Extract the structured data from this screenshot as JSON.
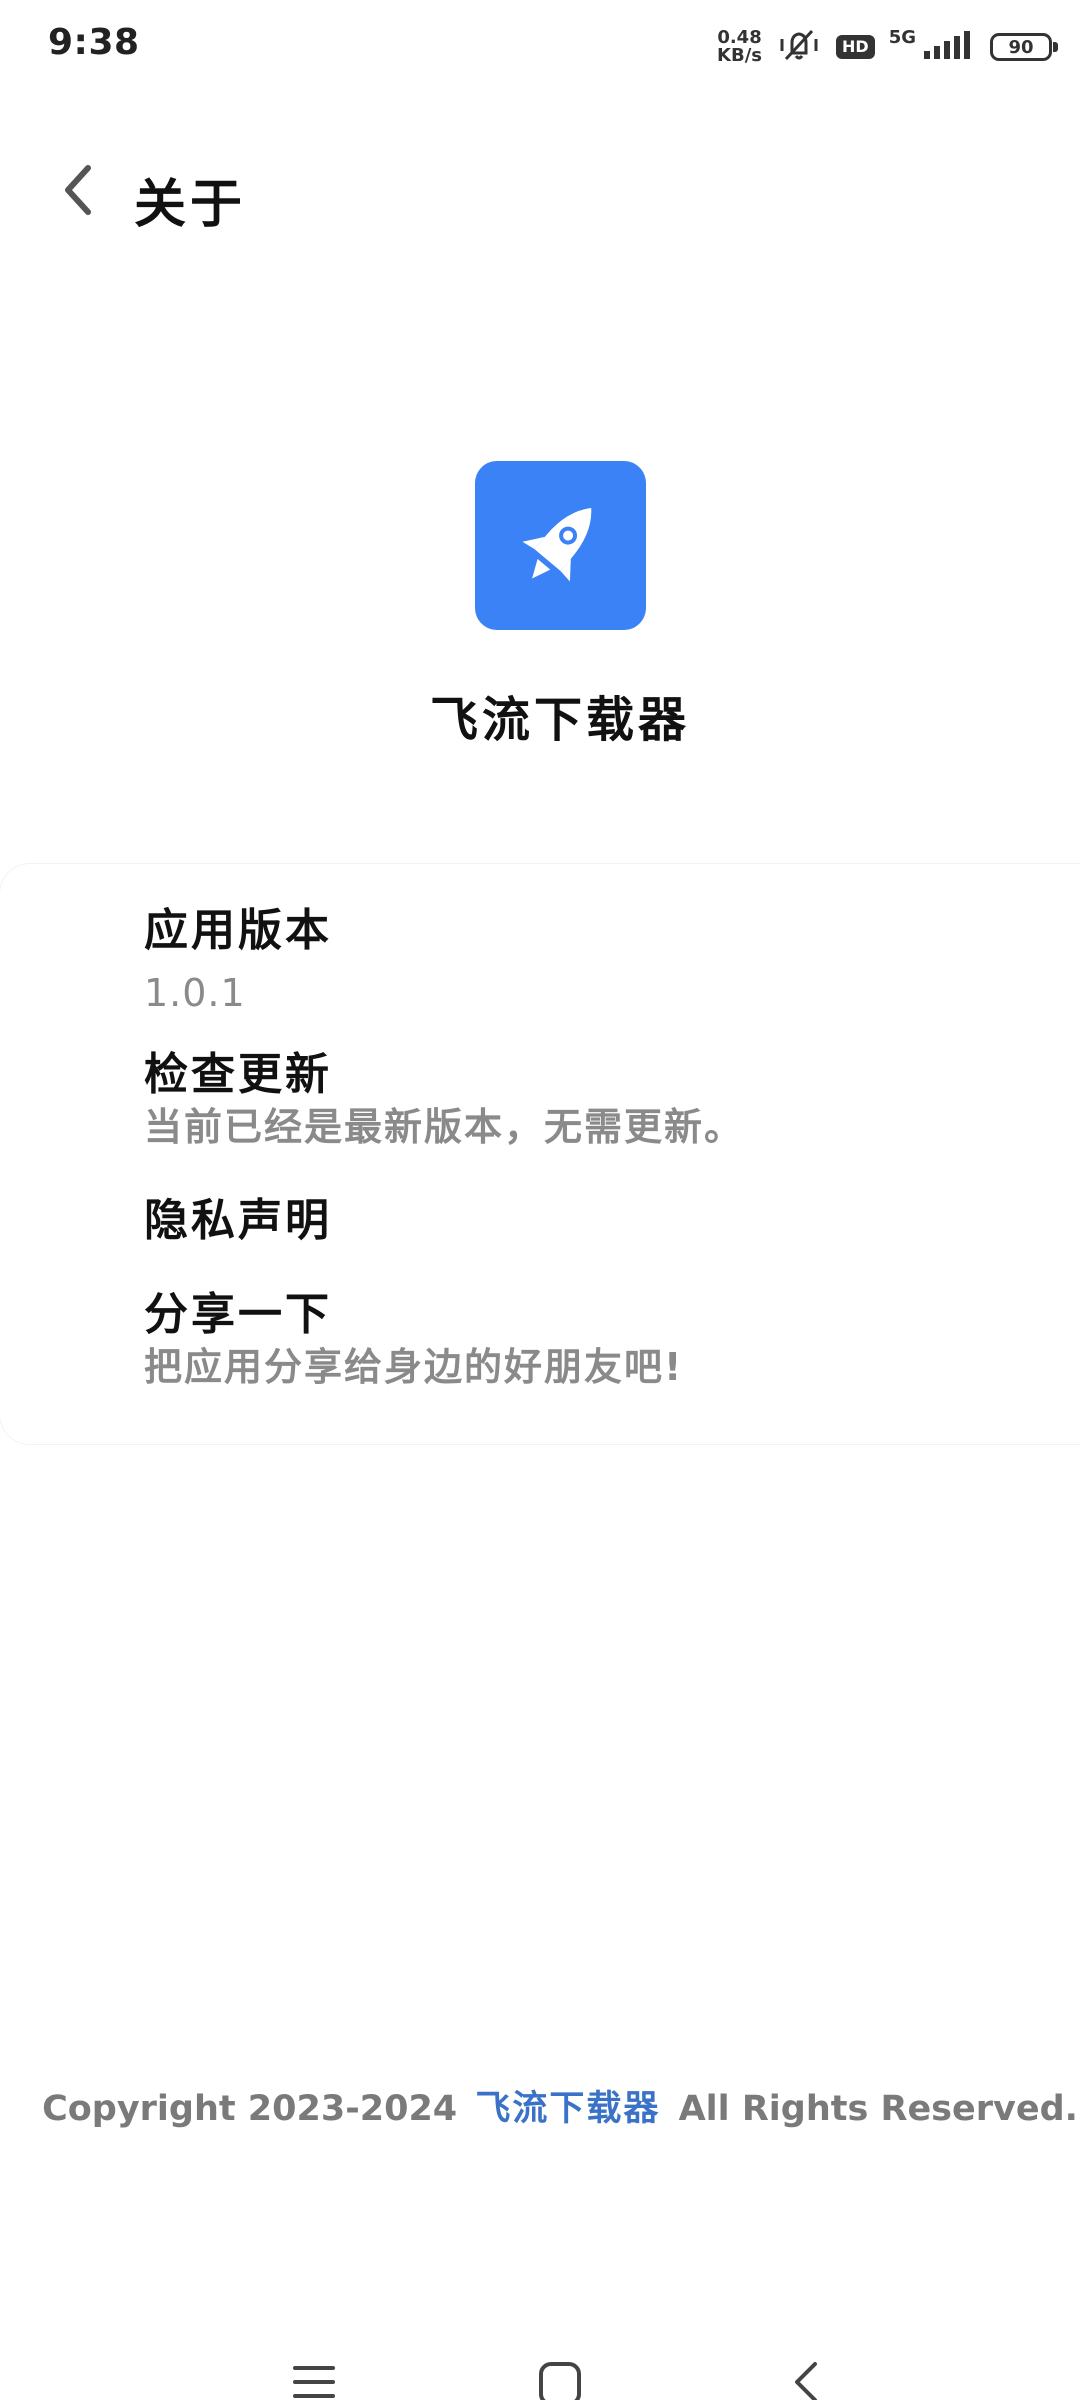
{
  "status_bar": {
    "time": "9:38",
    "net_speed_value": "0.48",
    "net_speed_unit": "KB/s",
    "hd": "HD",
    "network": "5G",
    "battery": "90"
  },
  "header": {
    "title": "关于"
  },
  "app": {
    "name": "飞流下载器",
    "logo_color": "#3b82f6"
  },
  "items": [
    {
      "title": "应用版本",
      "subtitle": "1.0.1"
    },
    {
      "title": "检查更新",
      "subtitle": "当前已经是最新版本，无需更新。"
    },
    {
      "title": "隐私声明"
    },
    {
      "title": "分享一下",
      "subtitle": "把应用分享给身边的好朋友吧!"
    }
  ],
  "footer": {
    "prefix": "Copyright 2023-2024",
    "brand": "飞流下载器",
    "suffix": "All Rights Reserved.",
    "brand_color": "#3a72c8"
  },
  "icons": {
    "back": "chevron-left-icon",
    "logo": "rocket-icon",
    "nav_menu": "menu-icon",
    "nav_home": "home-square-icon",
    "nav_back": "back-chevron-icon"
  }
}
